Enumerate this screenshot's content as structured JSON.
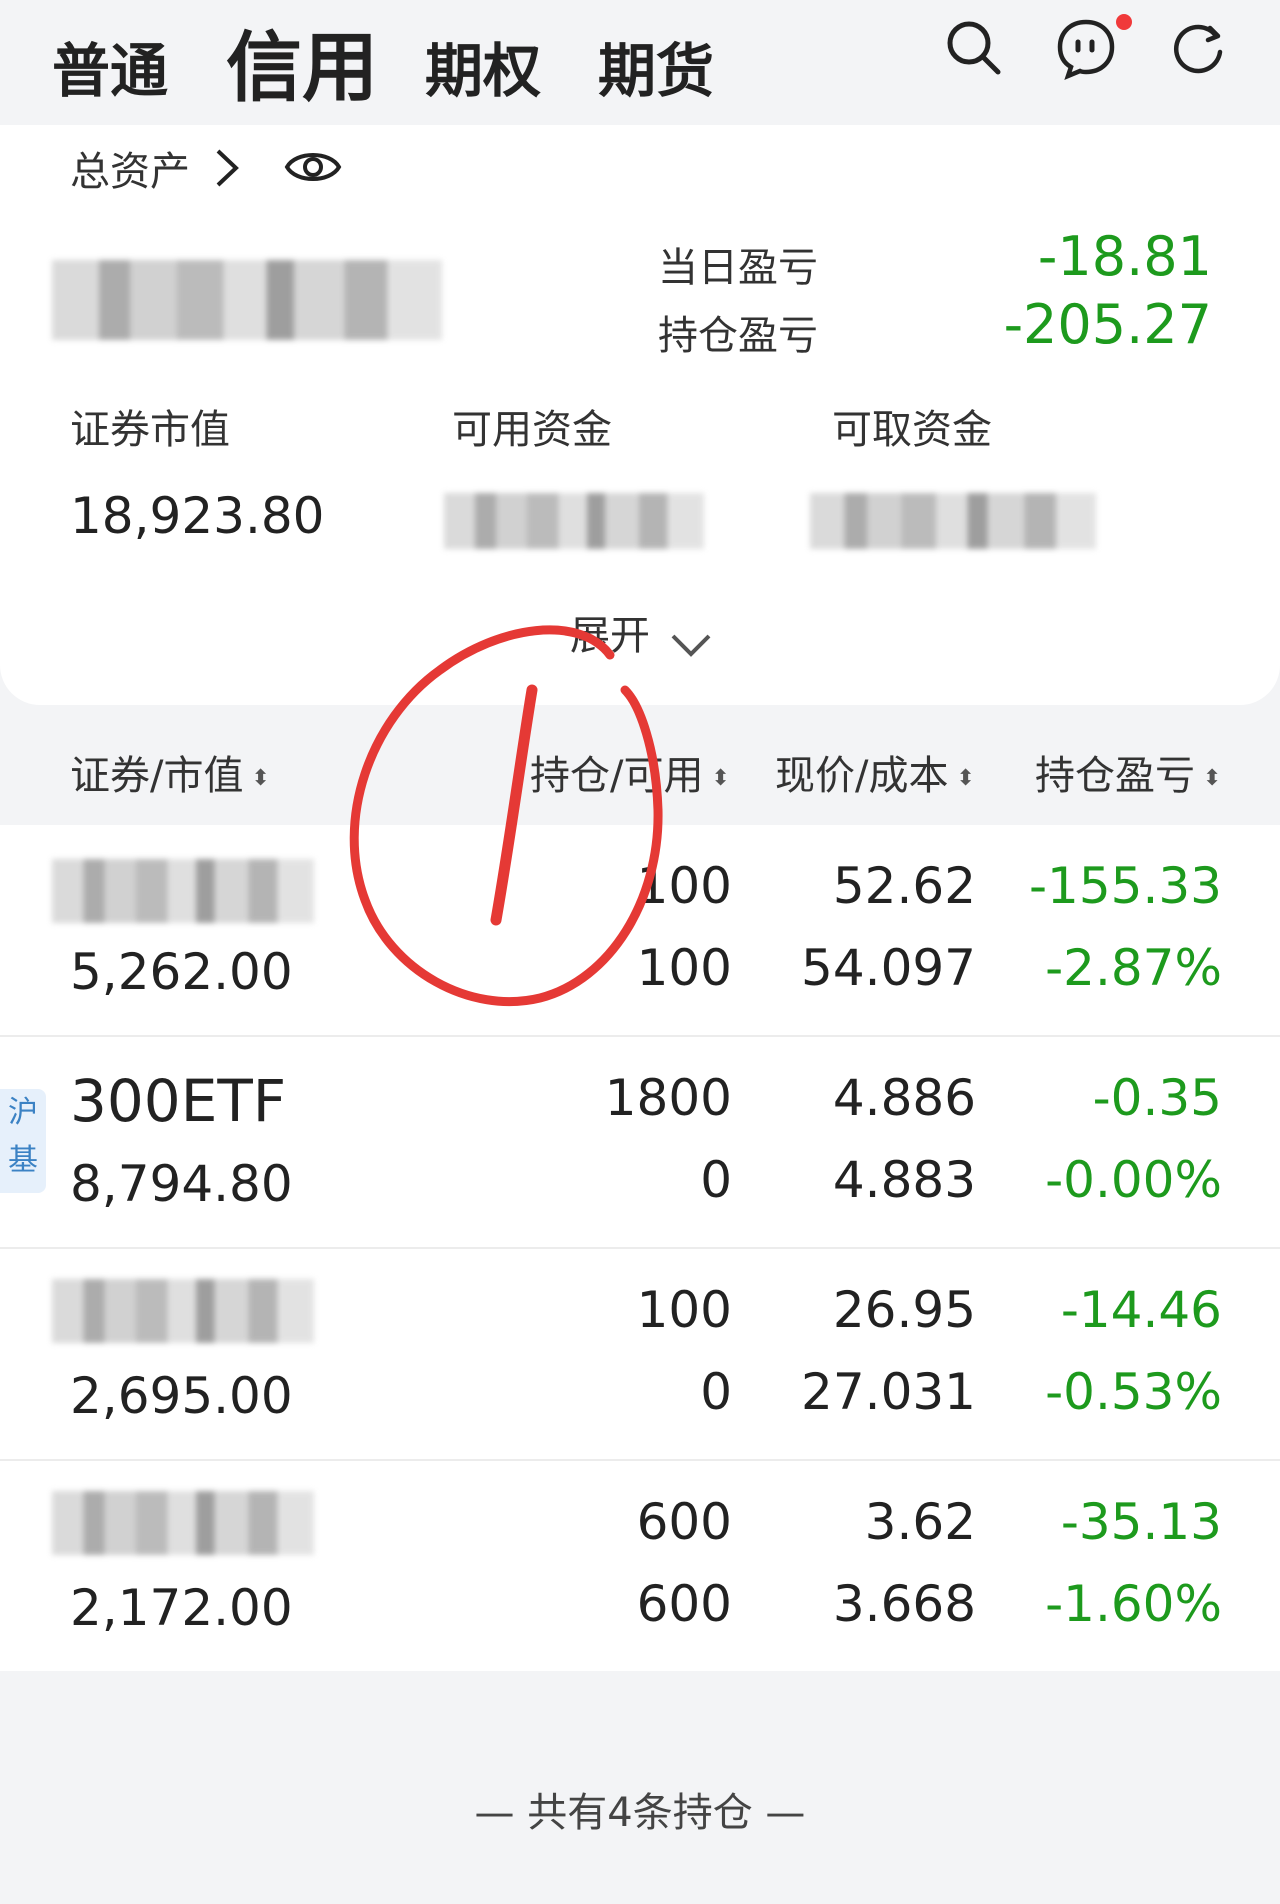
{
  "tabs": [
    {
      "label": "普通"
    },
    {
      "label": "信用"
    },
    {
      "label": "期权"
    },
    {
      "label": "期货"
    }
  ],
  "asset": {
    "total_label": "总资产",
    "daily_pnl_label": "当日盈亏",
    "daily_pnl_value": "-18.81",
    "position_pnl_label": "持仓盈亏",
    "position_pnl_value": "-205.27",
    "securities_value_label": "证券市值",
    "securities_value": "18,923.80",
    "available_funds_label": "可用资金",
    "withdrawable_funds_label": "可取资金",
    "expand_label": "展开"
  },
  "table": {
    "headers": [
      "证券/市值",
      "持仓/可用",
      "现价/成本",
      "持仓盈亏"
    ],
    "rows": [
      {
        "name": "",
        "market_value": "5,262.00",
        "position": "100",
        "available": "100",
        "price": "52.62",
        "cost": "54.097",
        "pnl": "-155.33",
        "pnl_pct": "-2.87%"
      },
      {
        "name": "300ETF",
        "tag": "沪基",
        "market_value": "8,794.80",
        "position": "1800",
        "available": "0",
        "price": "4.886",
        "cost": "4.883",
        "pnl": "-0.35",
        "pnl_pct": "-0.00%"
      },
      {
        "name": "",
        "market_value": "2,695.00",
        "position": "100",
        "available": "0",
        "price": "26.95",
        "cost": "27.031",
        "pnl": "-14.46",
        "pnl_pct": "-0.53%"
      },
      {
        "name": "",
        "market_value": "2,172.00",
        "position": "600",
        "available": "600",
        "price": "3.62",
        "cost": "3.668",
        "pnl": "-35.13",
        "pnl_pct": "-1.60%"
      }
    ]
  },
  "footer": "—  共有4条持仓  —",
  "colors": {
    "loss": "#1d9a1d",
    "accent_red": "#f0393a",
    "annotation": "#e53935"
  },
  "icons": [
    "search-icon",
    "message-icon",
    "refresh-icon",
    "chevron-right-icon",
    "eye-icon",
    "chevron-down-icon",
    "sort-icon"
  ]
}
